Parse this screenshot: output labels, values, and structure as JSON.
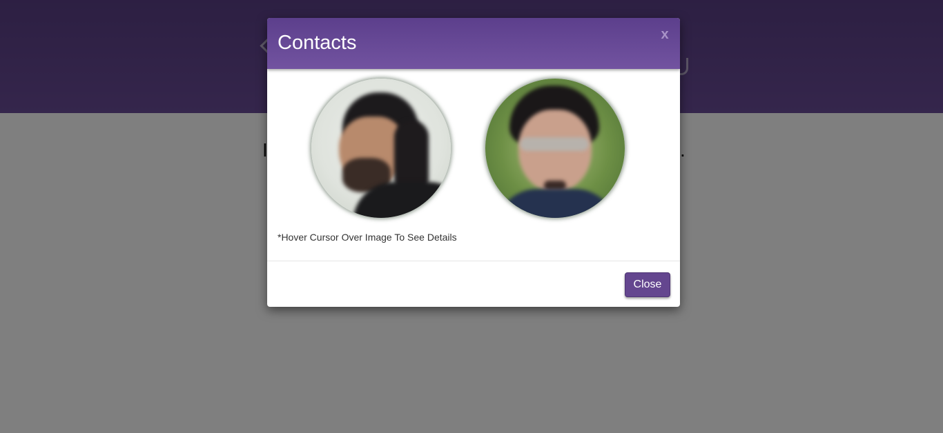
{
  "background": {
    "header_color": "#6a4c98",
    "left_char": "I",
    "right_char": "."
  },
  "modal": {
    "title": "Contacts",
    "close_x": "x",
    "hint": "*Hover Cursor Over Image To See Details",
    "close_button": "Close",
    "header_color": "#6b4e9b",
    "button_color": "#64468f"
  },
  "contacts": [
    {
      "icon": "person-photo-blurred"
    },
    {
      "icon": "person-photo-blurred"
    }
  ]
}
